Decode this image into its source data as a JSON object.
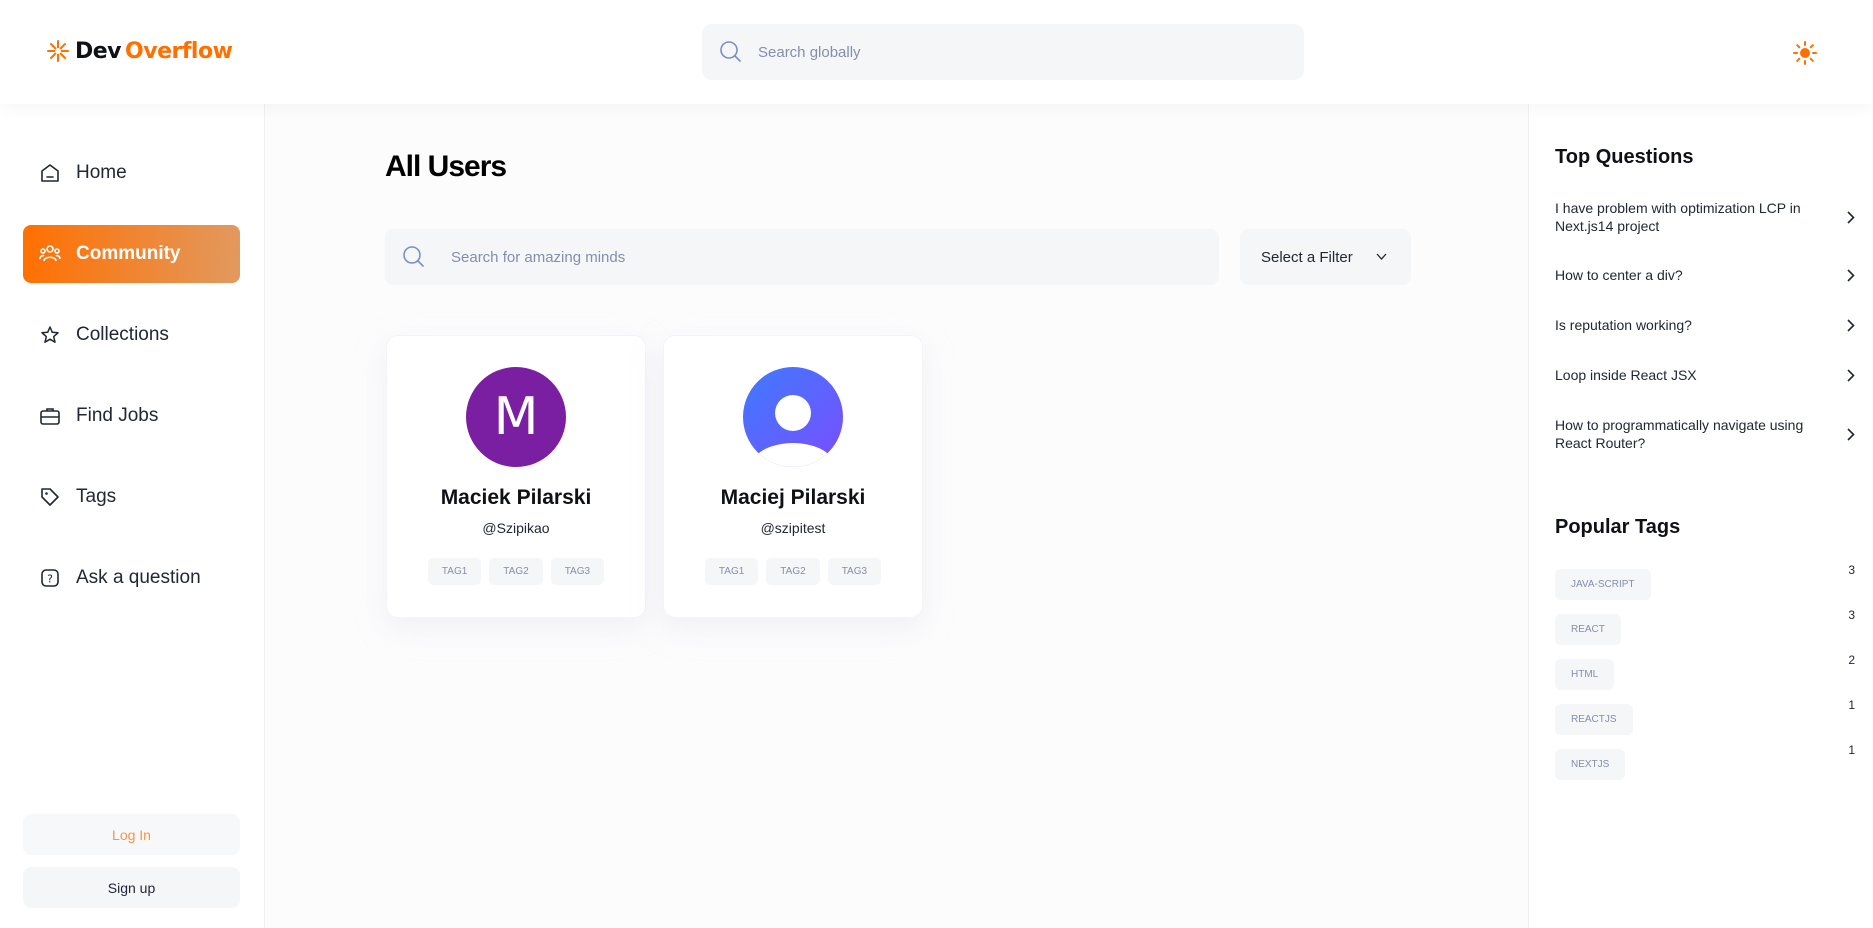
{
  "header": {
    "logo_prefix": "Dev",
    "logo_suffix": "Overflow",
    "search_placeholder": "Search globally"
  },
  "sidebar": {
    "items": [
      {
        "label": "Home",
        "icon": "home-icon"
      },
      {
        "label": "Community",
        "icon": "community-icon",
        "active": true
      },
      {
        "label": "Collections",
        "icon": "star-icon"
      },
      {
        "label": "Find Jobs",
        "icon": "briefcase-icon"
      },
      {
        "label": "Tags",
        "icon": "tag-icon"
      },
      {
        "label": "Ask a question",
        "icon": "question-icon"
      }
    ],
    "login_label": "Log In",
    "signup_label": "Sign up"
  },
  "main": {
    "title": "All Users",
    "search_placeholder": "Search for amazing minds",
    "filter_label": "Select a Filter",
    "users": [
      {
        "name": "Maciek Pilarski",
        "handle": "@Szipikao",
        "avatar_letter": "M",
        "tags": [
          "TAG1",
          "TAG2",
          "TAG3"
        ]
      },
      {
        "name": "Maciej Pilarski",
        "handle": "@szipitest",
        "avatar_letter": "",
        "tags": [
          "TAG1",
          "TAG2",
          "TAG3"
        ]
      }
    ]
  },
  "right_sidebar": {
    "top_questions_heading": "Top Questions",
    "questions": [
      "I have problem with optimization LCP in Next.js14 project",
      "How to center a div?",
      "Is reputation working?",
      "Loop inside React JSX",
      "How to programmatically navigate using React Router?"
    ],
    "popular_tags_heading": "Popular Tags",
    "popular_tags": [
      {
        "name": "JAVA-SCRIPT",
        "count": "3"
      },
      {
        "name": "REACT",
        "count": "3"
      },
      {
        "name": "HTML",
        "count": "2"
      },
      {
        "name": "REACTJS",
        "count": "1"
      },
      {
        "name": "NEXTJS",
        "count": "1"
      }
    ]
  },
  "colors": {
    "accent": "#ff7000",
    "accent_gradient_end": "#e2995f",
    "avatar_purple": "#7b1fa2",
    "avatar_blue": "#4f6bff"
  }
}
